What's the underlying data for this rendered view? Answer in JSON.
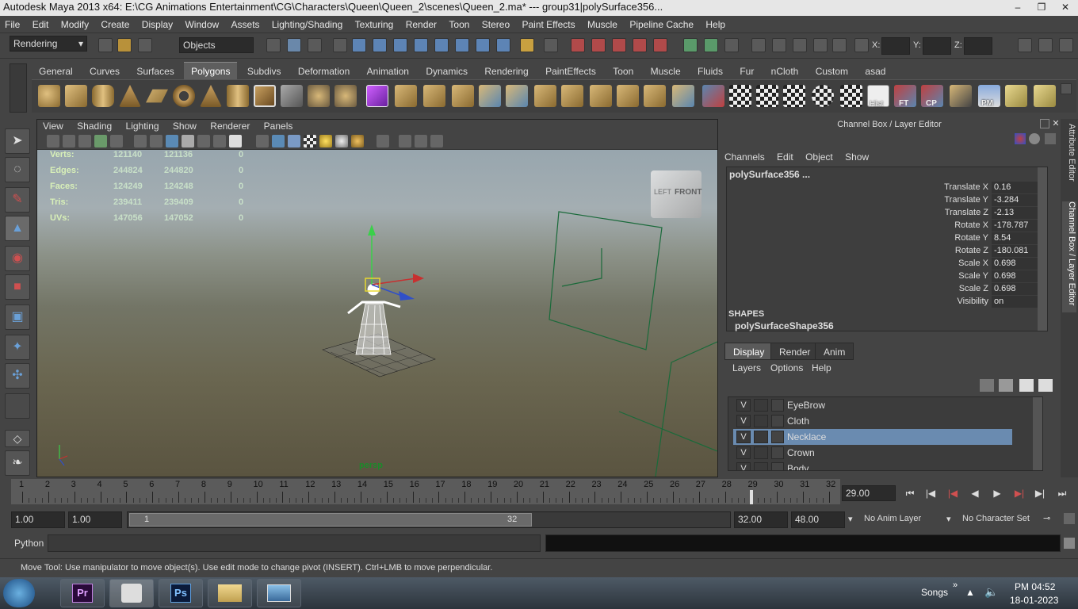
{
  "window": {
    "title": "Autodesk Maya 2013 x64: E:\\CG Animations Entertainment\\CG\\Characters\\Queen\\Queen_2\\scenes\\Queen_2.ma*   ---   group31|polySurface356...",
    "minimize": "–",
    "maximize": "❐",
    "close": "✕"
  },
  "menubar": [
    "File",
    "Edit",
    "Modify",
    "Create",
    "Display",
    "Window",
    "Assets",
    "Lighting/Shading",
    "Texturing",
    "Render",
    "Toon",
    "Stereo",
    "Paint Effects",
    "Muscle",
    "Pipeline Cache",
    "Help"
  ],
  "statusline": {
    "menuset": "Rendering",
    "selection_mode": "Objects",
    "x_label": "X:",
    "y_label": "Y:",
    "z_label": "Z:"
  },
  "shelf_tabs": [
    "General",
    "Curves",
    "Surfaces",
    "Polygons",
    "Subdivs",
    "Deformation",
    "Animation",
    "Dynamics",
    "Rendering",
    "PaintEffects",
    "Toon",
    "Muscle",
    "Fluids",
    "Fur",
    "nCloth",
    "Custom",
    "asad"
  ],
  "shelf_active": "Polygons",
  "shelf_labels": {
    "hist": "Hist",
    "ft": "FT",
    "cp": "CP",
    "pm": "PM"
  },
  "viewport": {
    "menu": [
      "View",
      "Shading",
      "Lighting",
      "Show",
      "Renderer",
      "Panels"
    ],
    "camera": "persp",
    "viewcube": {
      "left": "LEFT",
      "front": "FRONT"
    },
    "hud": [
      {
        "label": "Verts:",
        "a": "121140",
        "b": "121136",
        "c": "0"
      },
      {
        "label": "Edges:",
        "a": "244824",
        "b": "244820",
        "c": "0"
      },
      {
        "label": "Faces:",
        "a": "124249",
        "b": "124248",
        "c": "0"
      },
      {
        "label": "Tris:",
        "a": "239411",
        "b": "239409",
        "c": "0"
      },
      {
        "label": "UVs:",
        "a": "147056",
        "b": "147052",
        "c": "0"
      }
    ]
  },
  "channel_box": {
    "title": "Channel Box / Layer Editor",
    "menu": [
      "Channels",
      "Edit",
      "Object",
      "Show"
    ],
    "object": "polySurface356 ...",
    "attributes": [
      {
        "name": "Translate X",
        "value": "0.16"
      },
      {
        "name": "Translate Y",
        "value": "-3.284"
      },
      {
        "name": "Translate Z",
        "value": "-2.13"
      },
      {
        "name": "Rotate X",
        "value": "-178.787"
      },
      {
        "name": "Rotate Y",
        "value": "8.54"
      },
      {
        "name": "Rotate Z",
        "value": "-180.081"
      },
      {
        "name": "Scale X",
        "value": "0.698"
      },
      {
        "name": "Scale Y",
        "value": "0.698"
      },
      {
        "name": "Scale Z",
        "value": "0.698"
      },
      {
        "name": "Visibility",
        "value": "on"
      }
    ],
    "shapes_header": "SHAPES",
    "shape_name": "polySurfaceShape356",
    "side_tabs": [
      "Attribute Editor",
      "Channel Box / Layer Editor"
    ]
  },
  "layer_editor": {
    "tabs": [
      "Display",
      "Render",
      "Anim"
    ],
    "menu": [
      "Layers",
      "Options",
      "Help"
    ],
    "layers": [
      {
        "v": "V",
        "name": "EyeBrow",
        "selected": false
      },
      {
        "v": "V",
        "name": "Cloth",
        "selected": false
      },
      {
        "v": "V",
        "name": "Necklace",
        "selected": true
      },
      {
        "v": "V",
        "name": "Crown",
        "selected": false
      },
      {
        "v": "V",
        "name": "Body",
        "selected": false
      }
    ]
  },
  "timeline": {
    "ticks": [
      "1",
      "2",
      "3",
      "4",
      "5",
      "6",
      "7",
      "8",
      "9",
      "10",
      "11",
      "12",
      "13",
      "14",
      "15",
      "16",
      "17",
      "18",
      "19",
      "20",
      "21",
      "22",
      "23",
      "24",
      "25",
      "26",
      "27",
      "28",
      "29",
      "30",
      "31",
      "32"
    ],
    "current_frame": "29.00",
    "current_frame_value": 29
  },
  "range": {
    "anim_start": "1.00",
    "range_start": "1.00",
    "slider_start": "1",
    "slider_end": "32",
    "range_end": "32.00",
    "anim_end": "48.00",
    "anim_layer": "No Anim Layer",
    "character_set": "No Character Set"
  },
  "command_line": {
    "label": "Python"
  },
  "help_line": "Move Tool: Use manipulator to move object(s). Use edit mode to change pivot (INSERT).  Ctrl+LMB to move perpendicular.",
  "taskbar": {
    "items": [
      "Pr",
      "",
      "Ps",
      "",
      ""
    ],
    "tray_label": "Songs",
    "time": "PM 04:52",
    "date": "18-01-2023"
  },
  "colors": {
    "accent": "#6a8bb0",
    "ui_bg": "#444444",
    "field_bg": "#2b2b2b"
  }
}
